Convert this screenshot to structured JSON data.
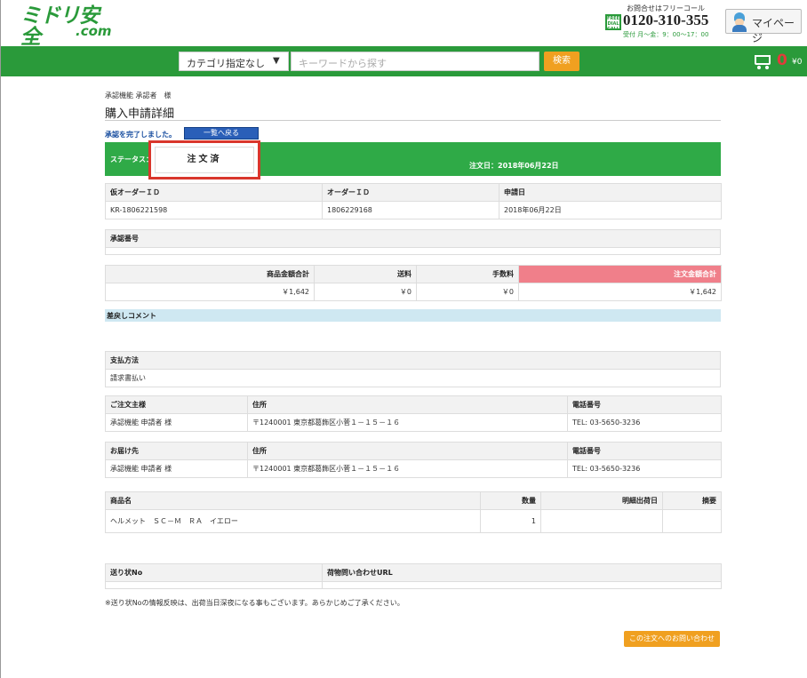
{
  "header": {
    "logo_main": "ミドリ安全",
    "logo_sub": ".com",
    "contact_note": "お問合せはフリーコール",
    "free_badge": "FREE DIAL CALL",
    "phone": "0120-310-355",
    "hours": "受付 月〜金：9：00〜17：00",
    "mypage_label": "マイページ"
  },
  "search": {
    "category_label": "カテゴリ指定なし",
    "keyword_placeholder": "キーワードから探す",
    "search_button": "検索"
  },
  "cart": {
    "count": "0",
    "total": "¥0"
  },
  "breadcrumb": "承認機能 承認者　様",
  "page_title": "購入申請詳細",
  "approval_message": "承認を完了しました。",
  "back_button": "一覧へ戻る",
  "status": {
    "label": "ステータス：",
    "value": "注文済",
    "order_date": "注文日：2018年06月22日"
  },
  "order_ids": {
    "headers": [
      "仮オーダーＩＤ",
      "オーダーＩＤ",
      "申請日"
    ],
    "values": [
      "KR-1806221598",
      "1806229168",
      "2018年06月22日"
    ]
  },
  "approval_number": {
    "header": "承認番号",
    "value": ""
  },
  "amounts": {
    "headers": [
      "商品金額合計",
      "送料",
      "手数料",
      "注文金額合計"
    ],
    "values": [
      "￥1,642",
      "￥0",
      "￥0",
      "￥1,642"
    ]
  },
  "comment_header": "差戻しコメント",
  "payment": {
    "header": "支払方法",
    "value": "請求書払い"
  },
  "orderer": {
    "headers": [
      "ご注文主様",
      "住所",
      "電話番号"
    ],
    "values": [
      "承認機能 申請者 様",
      "〒1240001 東京都葛飾区小菅１－１５－１６",
      "TEL: 03-5650-3236"
    ]
  },
  "shipping": {
    "headers": [
      "お届け先",
      "住所",
      "電話番号"
    ],
    "values": [
      "承認機能 申請者 様",
      "〒1240001 東京都葛飾区小菅１－１５－１６",
      "TEL: 03-5650-3236"
    ]
  },
  "items": {
    "headers": [
      "商品名",
      "数量",
      "明細出荷日",
      "摘要"
    ],
    "rows": [
      [
        "ヘルメット　ＳＣ－Ｍ　ＲＡ　イエロー",
        "1",
        "",
        ""
      ]
    ]
  },
  "tracking": {
    "headers": [
      "送り状No",
      "荷物問い合わせURL"
    ],
    "values": [
      "",
      ""
    ]
  },
  "tracking_note": "※送り状Noの情報反映は、出荷当日深夜になる事もございます。あらかじめご了承ください。",
  "inquiry_button": "この注文へのお問い合わせ"
}
